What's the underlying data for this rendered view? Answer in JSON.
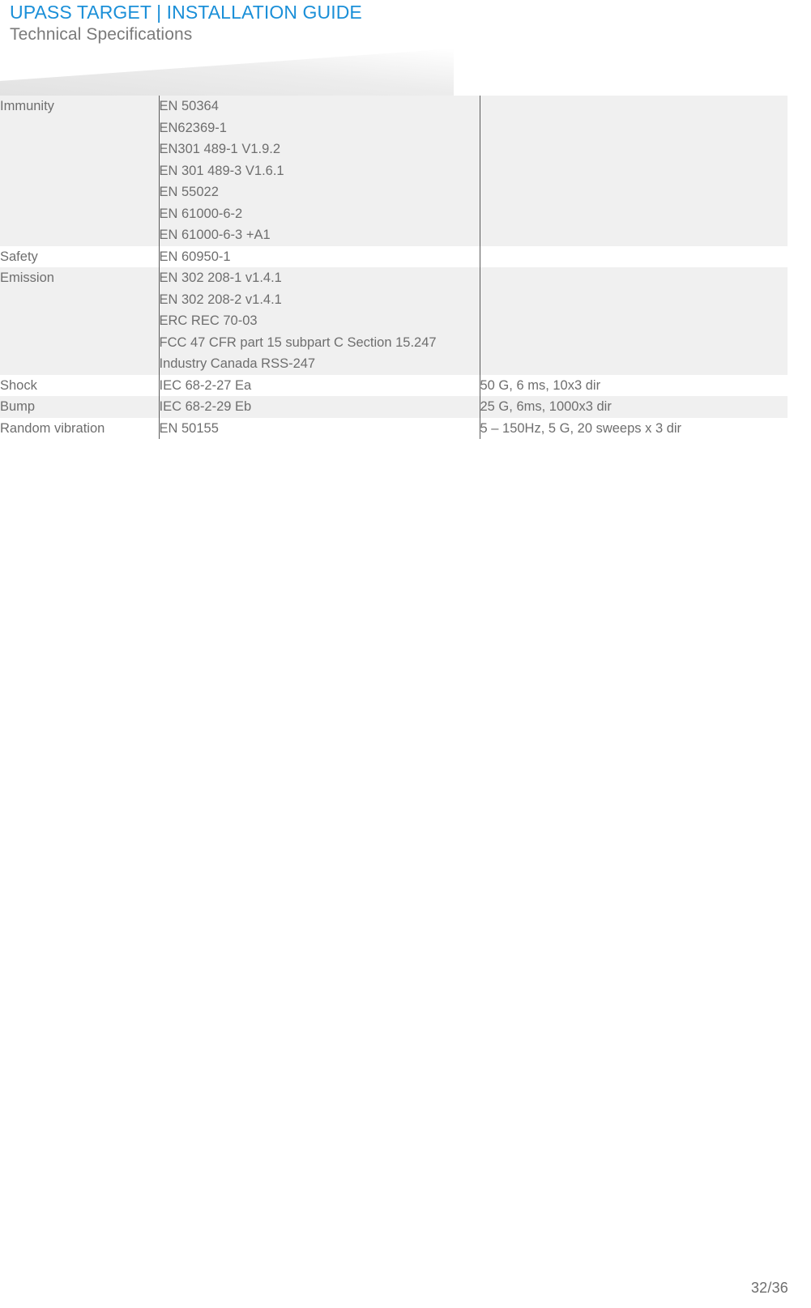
{
  "header": {
    "title": "UPASS TARGET | INSTALLATION GUIDE",
    "subtitle": "Technical Specifications",
    "title_color": "#1a8fd8",
    "subtitle_color": "#7a7a7a"
  },
  "table": {
    "rows": [
      {
        "label": "Immunity",
        "standard": "EN 50364\nEN62369-1\nEN301 489-1 V1.9.2\nEN 301 489-3 V1.6.1\nEN 55022\nEN 61000-6-2\nEN 61000-6-3 +A1",
        "value": "",
        "shaded": true
      },
      {
        "label": "Safety",
        "standard": "EN 60950-1",
        "value": "",
        "shaded": false
      },
      {
        "label": "Emission",
        "standard": "EN 302 208-1 v1.4.1\nEN 302 208-2 v1.4.1\nERC REC 70-03\nFCC 47 CFR part 15 subpart C Section 15.247\nIndustry Canada RSS-247",
        "value": "",
        "shaded": true
      },
      {
        "label": "Shock",
        "standard": "IEC 68-2-27 Ea",
        "value": "50 G, 6 ms, 10x3 dir",
        "shaded": false
      },
      {
        "label": "Bump",
        "standard": "IEC 68-2-29 Eb",
        "value": "25 G, 6ms, 1000x3 dir",
        "shaded": true
      },
      {
        "label": "Random vibration",
        "standard": "EN 50155",
        "value": "5 – 150Hz, 5 G, 20 sweeps x 3 dir",
        "shaded": false
      }
    ],
    "row_shaded_color": "#f0f0f0",
    "row_plain_color": "#ffffff",
    "divider_color": "#5a5a5a",
    "text_color": "#6e6e6e"
  },
  "footer": {
    "page_indicator": "32/36"
  }
}
